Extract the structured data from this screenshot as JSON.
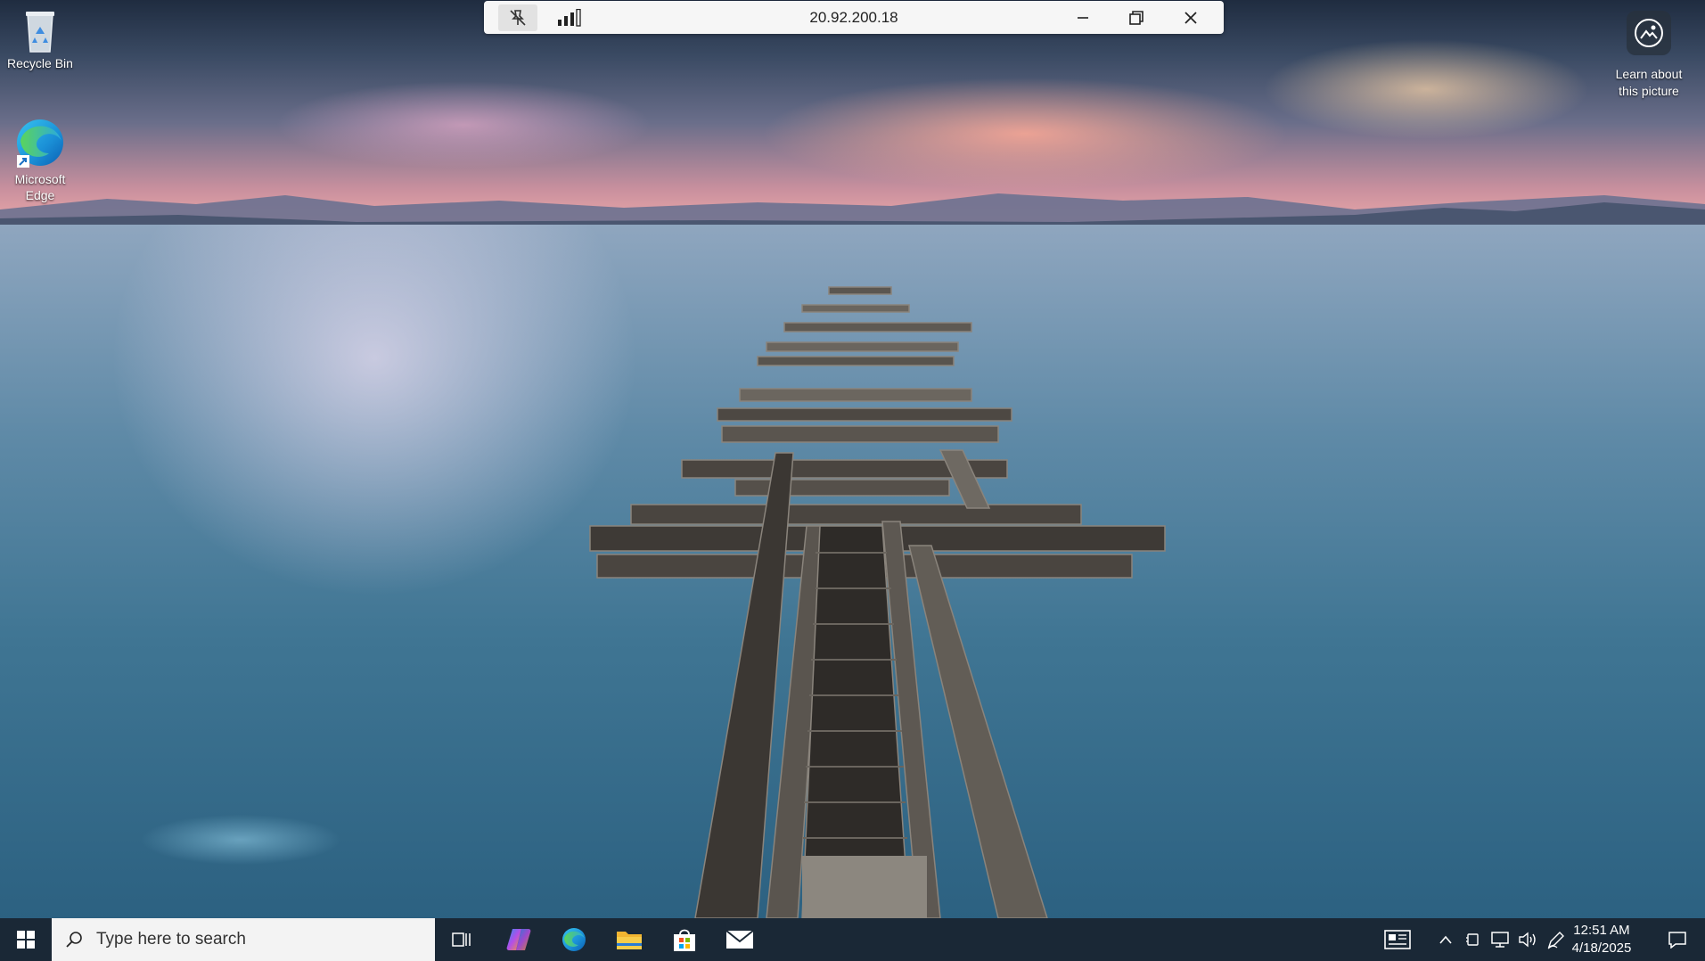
{
  "desktop": {
    "icons": [
      {
        "label": "Recycle Bin"
      },
      {
        "label": "Microsoft Edge"
      }
    ],
    "spotlight": {
      "label": "Learn about this picture"
    }
  },
  "remote_bar": {
    "title": "20.92.200.18"
  },
  "taskbar": {
    "search_placeholder": "Type here to search",
    "pinned": [
      "task-view",
      "copilot",
      "microsoft-edge",
      "file-explorer",
      "microsoft-store",
      "mail"
    ],
    "clock": {
      "time": "12:51 AM",
      "date": "4/18/2025"
    }
  },
  "colors": {
    "taskbar": "#1a2836",
    "remote_bar": "#f6f6f6",
    "search_box": "#f3f3f3"
  }
}
